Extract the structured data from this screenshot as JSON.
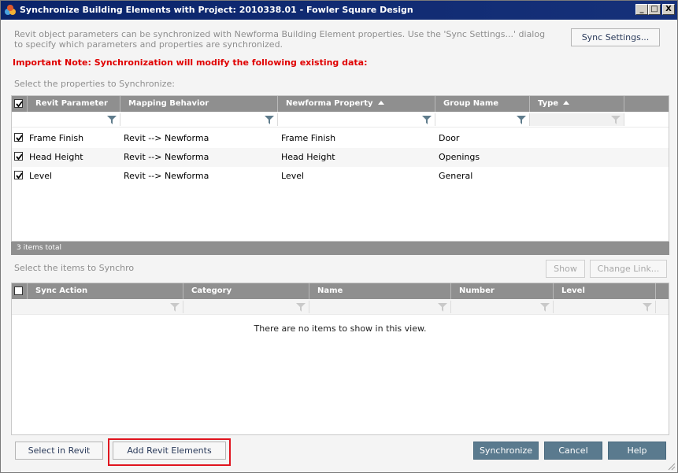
{
  "window": {
    "title": "Synchronize Building Elements with Project: 2010338.01 - Fowler Square Design",
    "min_glyph": "_",
    "max_glyph": "□",
    "close_glyph": "X"
  },
  "description": "Revit object parameters can be synchronized with Newforma Building Element properties. Use the 'Sync Settings...' dialog to specify which parameters and properties are synchronized.",
  "sync_settings_label": "Sync Settings...",
  "important_note": "Important Note: Synchronization will modify the following existing data:",
  "properties_section": {
    "label": "Select the properties to Synchronize:",
    "columns": {
      "revit_parameter": "Revit Parameter",
      "mapping_behavior": "Mapping Behavior",
      "newforma_property": "Newforma Property",
      "group_name": "Group Name",
      "type": "Type"
    },
    "rows": [
      {
        "checked": true,
        "revit_parameter": "Frame Finish",
        "mapping_behavior": "Revit --> Newforma",
        "newforma_property": "Frame Finish",
        "group_name": "Door",
        "type": ""
      },
      {
        "checked": true,
        "revit_parameter": "Head Height",
        "mapping_behavior": "Revit --> Newforma",
        "newforma_property": "Head Height",
        "group_name": "Openings",
        "type": ""
      },
      {
        "checked": true,
        "revit_parameter": "Level",
        "mapping_behavior": "Revit --> Newforma",
        "newforma_property": "Level",
        "group_name": "General",
        "type": ""
      }
    ],
    "total": "3 items total"
  },
  "items_section": {
    "label": "Select the items to Synchro",
    "show_label": "Show",
    "change_link_label": "Change Link...",
    "columns": {
      "sync_action": "Sync Action",
      "category": "Category",
      "name": "Name",
      "number": "Number",
      "level": "Level"
    },
    "empty_message": "There are no items to show in this view."
  },
  "buttons": {
    "select_in_revit": "Select in Revit",
    "add_revit_elements": "Add Revit Elements",
    "synchronize": "Synchronize",
    "cancel": "Cancel",
    "help": "Help"
  },
  "colors": {
    "title_bar": "#0a246a",
    "note_text": "#e00000",
    "grid_header": "#8f8f8f",
    "primary_button": "#5a7a8e",
    "highlight_box": "#e0141e"
  }
}
